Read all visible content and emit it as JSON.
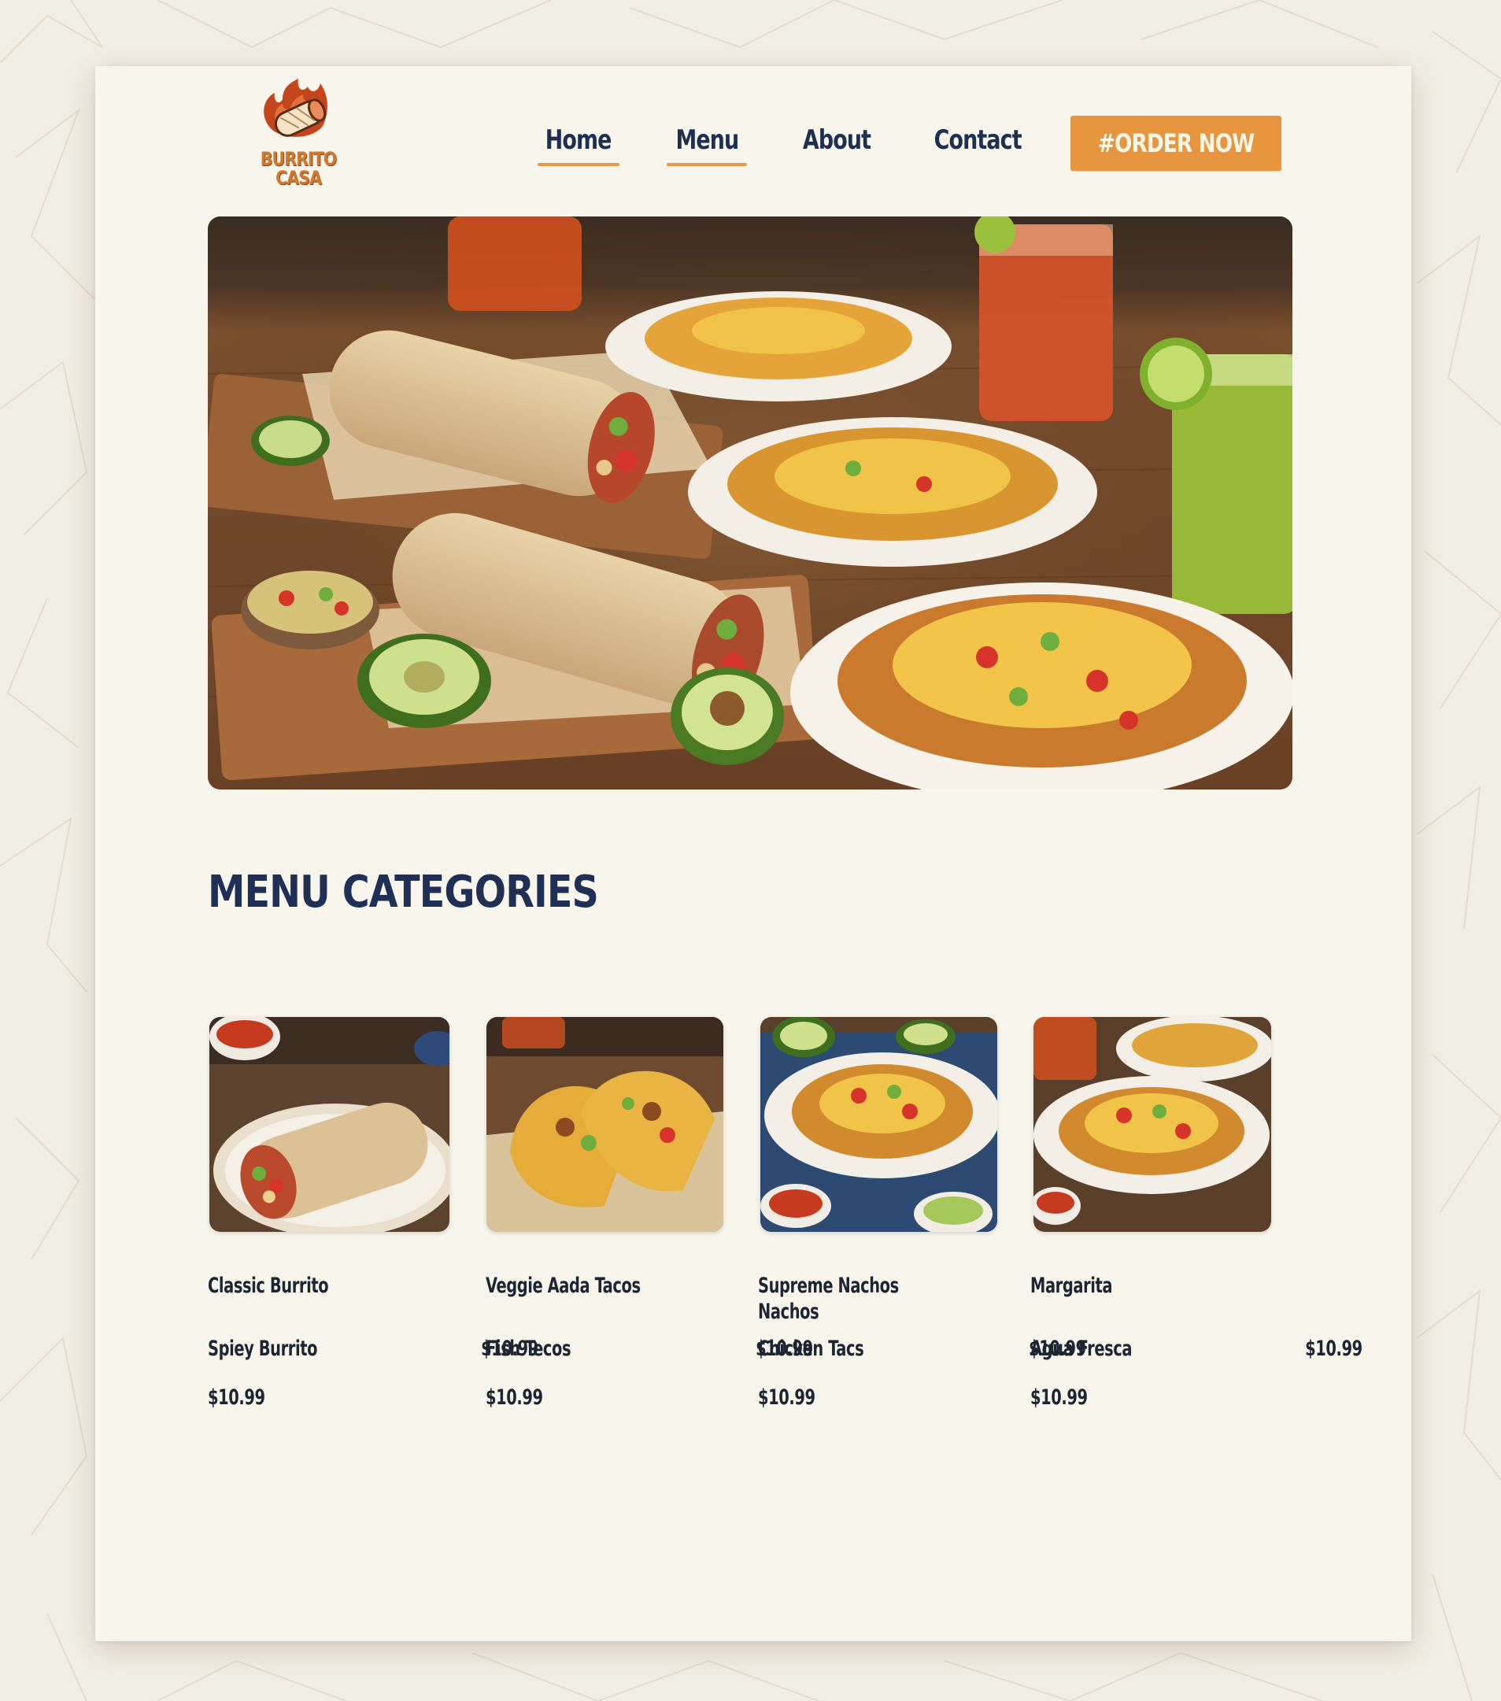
{
  "brand": {
    "line1": "BURRITO",
    "line2": "CASA"
  },
  "nav": {
    "home": "Home",
    "menu": "Menu",
    "about": "About",
    "contact": "Contact"
  },
  "order_button": "#ORDER NOW",
  "section_title": "MENU CATEGORIES",
  "cards": [
    {
      "name": "Classic Burrito",
      "item": "Spiey Burrito",
      "item_price": "$10.99",
      "price": "$10.99"
    },
    {
      "name": "Veggie Aada Tacos",
      "item": "Fish Tecos",
      "item_price": "$10.99",
      "price": "$10.99"
    },
    {
      "name_line1": "Supreme Nachos",
      "name_line2": "Nachos",
      "item": "Chicken Tacs",
      "item_price": "$10.99",
      "price": "$10.99"
    },
    {
      "name": "Margarita",
      "item": "Agua Fresca",
      "item_price": "$10.99",
      "price": "$10.99"
    }
  ],
  "colors": {
    "accent": "#e8953f",
    "navy": "#1f2f55",
    "page": "#f8f6ec"
  }
}
